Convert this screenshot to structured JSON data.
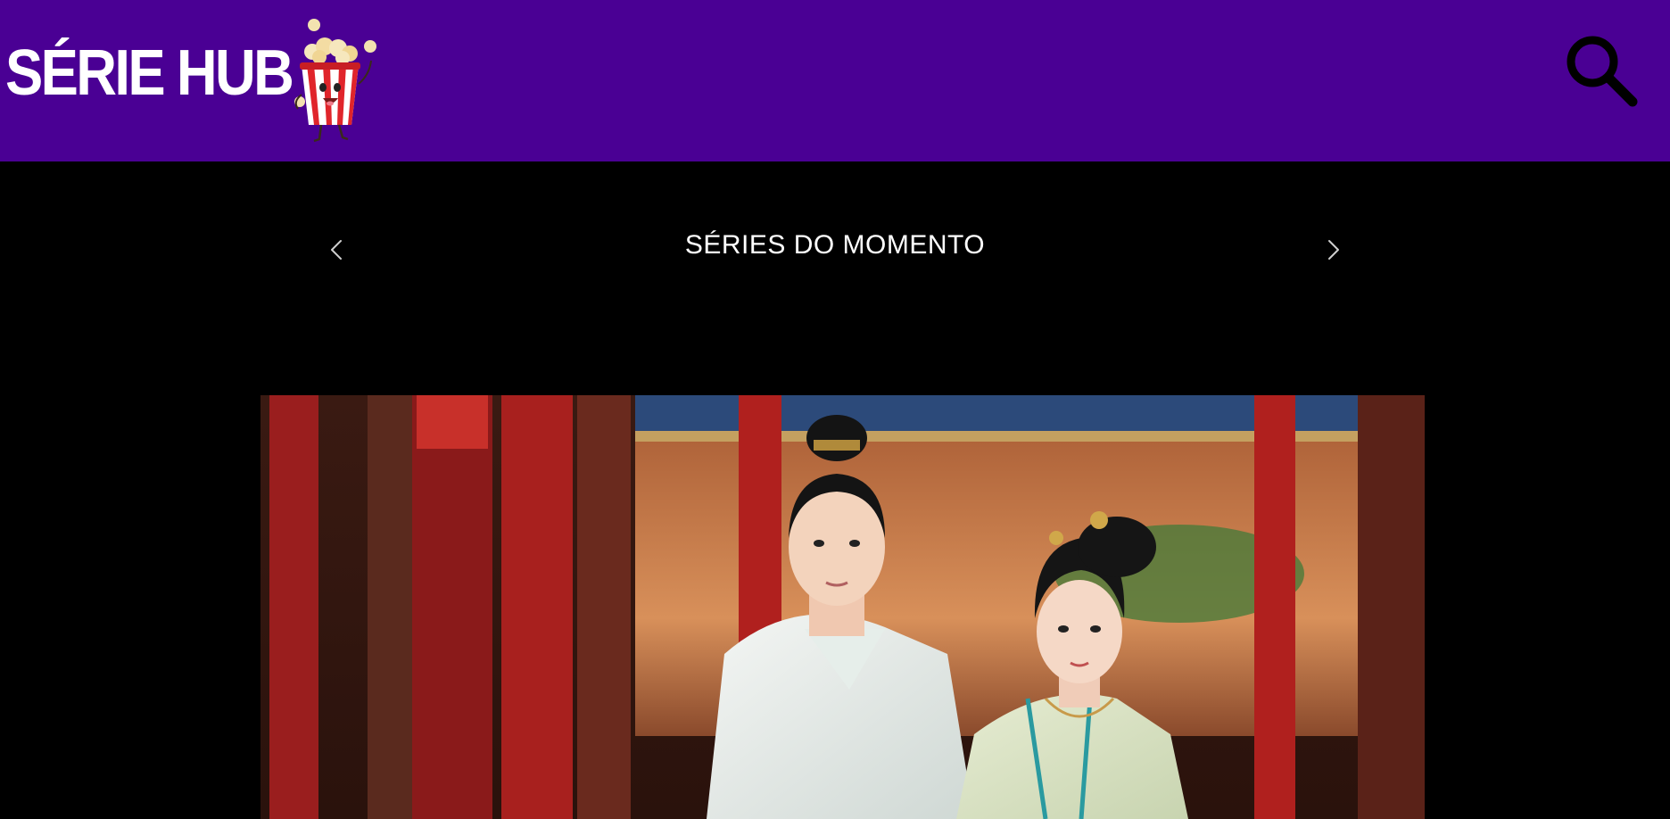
{
  "header": {
    "logo_text": "SÉRIE HUB",
    "mascot_icon": "popcorn-mascot-icon",
    "search_icon": "search-icon",
    "background_color": "#4a0094"
  },
  "main": {
    "section_title": "SÉRIES DO MOMENTO",
    "background_color": "#000000"
  },
  "carousel": {
    "prev_icon": "chevron-left-icon",
    "next_icon": "chevron-right-icon"
  }
}
